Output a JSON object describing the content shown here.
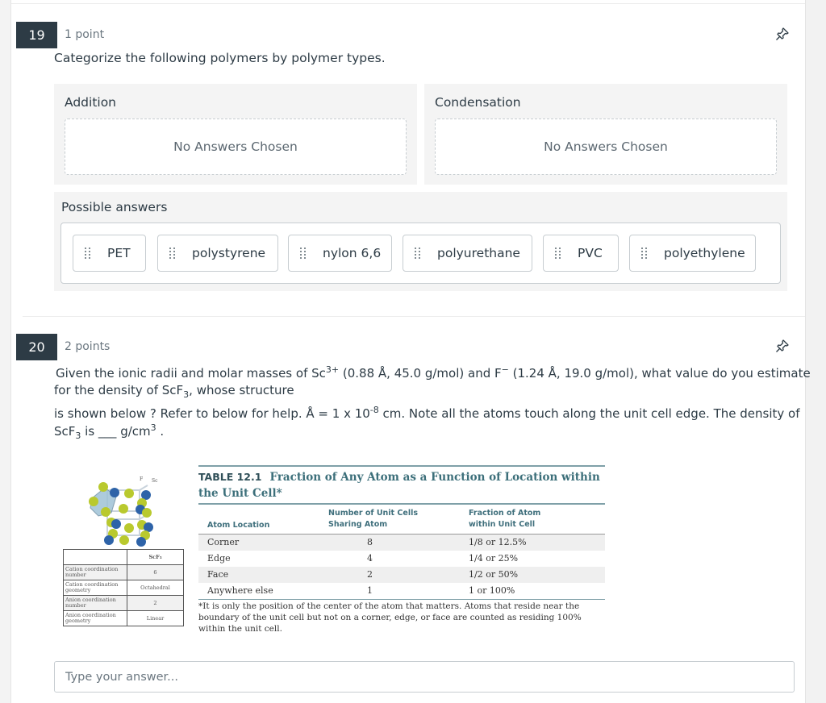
{
  "questions": [
    {
      "number": "19",
      "points": "1 point",
      "prompt": "Categorize the following polymers by polymer types.",
      "pin_icon": "pushpin-icon",
      "categories": [
        {
          "title": "Addition",
          "empty_text": "No Answers Chosen"
        },
        {
          "title": "Condensation",
          "empty_text": "No Answers Chosen"
        }
      ],
      "possible_answers_label": "Possible answers",
      "answers": [
        "PET",
        "polystyrene",
        "nylon 6,6",
        "polyurethane",
        "PVC",
        "polyethylene"
      ],
      "drag_handle_icon": "drag-grip-icon"
    },
    {
      "number": "20",
      "points": "2 points",
      "pin_icon": "pushpin-icon",
      "prompt": {
        "line1_a": "Given the ionic radii and molar masses of Sc",
        "line1_sup1": "3+",
        "line1_b": " (0.88 Å, 45.0 g/mol) and F",
        "line1_sup2": "−",
        "line1_c": " (1.24  Å, 19.0 g/mol), what value  do you estimate",
        "line2_a": "for the density of ScF",
        "line2_sub": "3",
        "line2_b": ", whose structure",
        "line3_a": "is shown below ? Refer to below for help.  Å = 1 x 10",
        "line3_sup": "-8",
        "line3_b": " cm. Note all the atoms touch along the unit cell edge.  The density of",
        "line4_a": "ScF",
        "line4_sub": "3",
        "line4_b": " is ___  g/cm",
        "line4_sup": "3",
        "line4_c": " ."
      },
      "structure_figure": {
        "labels": [
          "F",
          "Sc"
        ],
        "colors": {
          "F": "#b9c92e",
          "Sc": "#2e63a8"
        },
        "table": {
          "header": [
            "",
            "ScF₃"
          ],
          "rows": [
            [
              "Cation coordination number",
              "6"
            ],
            [
              "Cation coordination geometry",
              "Octahedral"
            ],
            [
              "Anion coordination number",
              "2"
            ],
            [
              "Anion coordination geometry",
              "Linear"
            ]
          ]
        }
      },
      "reference_table": {
        "label": "TABLE 12.1",
        "title": "Fraction of Any Atom as a Function of Location within the Unit Cell*",
        "columns": [
          "Atom Location",
          "Number of Unit Cells Sharing Atom",
          "Fraction of Atom within Unit Cell"
        ],
        "column_lines": [
          [
            "",
            "Atom Location"
          ],
          [
            "Number of Unit Cells",
            "Sharing Atom"
          ],
          [
            "Fraction of Atom",
            "within Unit Cell"
          ]
        ],
        "rows": [
          [
            "Corner",
            "8",
            "1/8 or 12.5%"
          ],
          [
            "Edge",
            "4",
            "1/4 or 25%"
          ],
          [
            "Face",
            "2",
            "1/2 or 50%"
          ],
          [
            "Anywhere else",
            "1",
            "1 or 100%"
          ]
        ],
        "footnote": "*It is only the position of the center of the atom that matters. Atoms that reside near the boundary of the unit cell but not on a corner, edge, or face are counted as residing 100% within the unit cell."
      },
      "answer_input": {
        "value": "",
        "placeholder": "Type your answer..."
      }
    }
  ]
}
